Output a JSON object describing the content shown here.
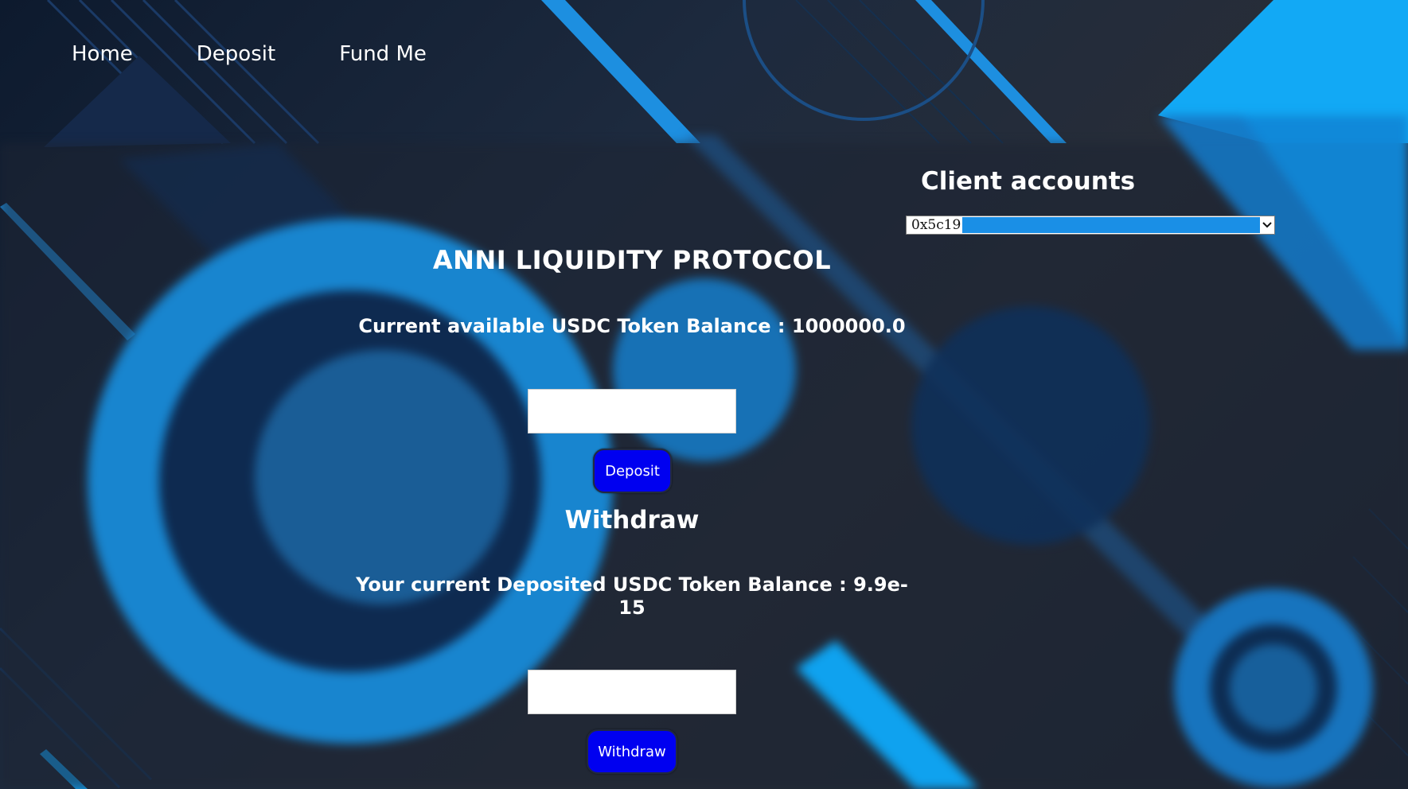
{
  "nav": {
    "items": [
      {
        "label": "Home"
      },
      {
        "label": "Deposit"
      },
      {
        "label": "Fund Me"
      }
    ]
  },
  "accounts": {
    "title": "Client accounts",
    "selected": "0x5c19"
  },
  "main": {
    "title": "ANNI LIQUIDITY PROTOCOL",
    "available_balance": "Current available USDC Token Balance : 1000000.0",
    "deposit_input_value": "",
    "deposit_button": "Deposit",
    "withdraw_title": "Withdraw",
    "deposited_balance": "Your current Deposited USDC Token Balance : 9.9e-15",
    "withdraw_input_value": "",
    "withdraw_button": "Withdraw"
  },
  "colors": {
    "button_bg": "#0000f0",
    "accent_blue": "#12a9f5",
    "background_dark": "#1d2a3e",
    "select_highlight": "#1a8fe6"
  },
  "icons": {
    "select_arrow": "chevron-down-icon"
  }
}
